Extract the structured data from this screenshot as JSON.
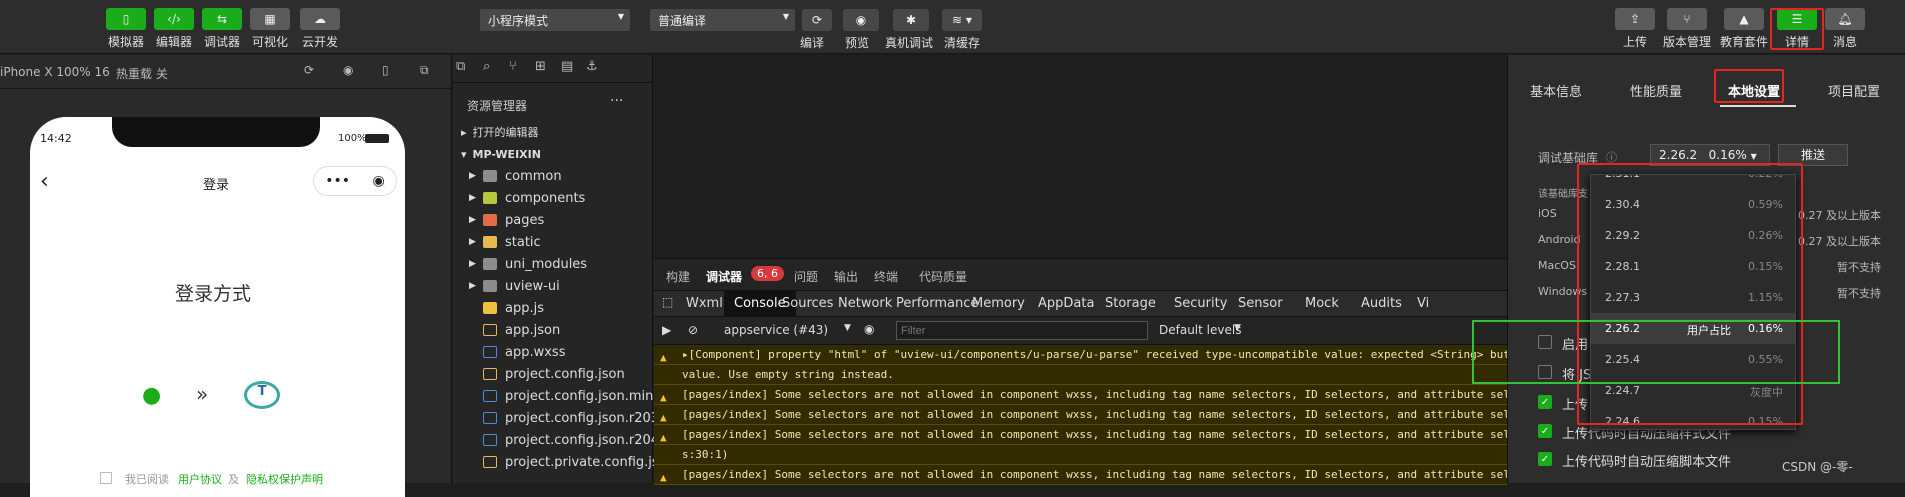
{
  "toolbar": {
    "left_buttons": [
      {
        "label": "模拟器",
        "icon": "phone-icon"
      },
      {
        "label": "编辑器",
        "icon": "code-icon"
      },
      {
        "label": "调试器",
        "icon": "debug-icon"
      },
      {
        "label": "可视化",
        "icon": "layout-icon"
      },
      {
        "label": "云开发",
        "icon": "cloud-icon"
      }
    ],
    "mode_select": "小程序模式",
    "compile_select": "普通编译",
    "mid_buttons": [
      {
        "label": "编译",
        "icon": "refresh-icon"
      },
      {
        "label": "预览",
        "icon": "eye-icon"
      },
      {
        "label": "真机调试",
        "icon": "bug-icon"
      },
      {
        "label": "清缓存",
        "icon": "layers-icon"
      }
    ],
    "right_buttons": [
      {
        "label": "上传",
        "icon": "upload-icon"
      },
      {
        "label": "版本管理",
        "icon": "branch-icon"
      },
      {
        "label": "教育套件",
        "icon": "graduation-icon"
      },
      {
        "label": "详情",
        "icon": "menu-icon"
      },
      {
        "label": "消息",
        "icon": "bell-icon"
      }
    ]
  },
  "simulator": {
    "device": "iPhone X 100% 16",
    "hot_reload": "热重载 关",
    "time": "14:42",
    "battery": "100%",
    "nav_title": "登录",
    "login_heading": "登录方式",
    "agree_text": "我已阅读",
    "link1": "用户协议",
    "and": "及",
    "link2": "隐私权保护声明",
    "arrow_text": "»"
  },
  "explorer": {
    "title": "资源管理器",
    "open_editors": "打开的编辑器",
    "root": "MP-WEIXIN",
    "items": [
      {
        "name": "common",
        "type": "folder"
      },
      {
        "name": "components",
        "type": "folder"
      },
      {
        "name": "pages",
        "type": "folder"
      },
      {
        "name": "static",
        "type": "folder"
      },
      {
        "name": "uni_modules",
        "type": "folder"
      },
      {
        "name": "uview-ui",
        "type": "folder"
      },
      {
        "name": "app.js",
        "type": "js"
      },
      {
        "name": "app.json",
        "type": "json"
      },
      {
        "name": "app.wxss",
        "type": "wxss"
      },
      {
        "name": "project.config.json",
        "type": "json"
      },
      {
        "name": "project.config.json.mine",
        "type": "file"
      },
      {
        "name": "project.config.json.r203",
        "type": "file"
      },
      {
        "name": "project.config.json.r204",
        "type": "file"
      },
      {
        "name": "project.private.config.js...",
        "type": "json"
      }
    ]
  },
  "console": {
    "top_tabs": [
      "构建",
      "调试器",
      "问题",
      "输出",
      "终端",
      "代码质量"
    ],
    "badge": "6, 6",
    "dev_tabs": [
      "Wxml",
      "Console",
      "Sources",
      "Network",
      "Performance",
      "Memory",
      "AppData",
      "Storage",
      "Security",
      "Sensor",
      "Mock",
      "Audits",
      "Vi"
    ],
    "context": "appservice (#43)",
    "filter_placeholder": "Filter",
    "levels": "Default levels",
    "logs": [
      "▸[Component] property \"html\" of \"uview-ui/components/u-parse/u-parse\" received type-uncompatible value: expected <String> but",
      "value. Use empty string instead.",
      "[pages/index] Some selectors are not allowed in component wxss, including tag name selectors, ID selectors, and attribute sele",
      "[pages/index] Some selectors are not allowed in component wxss, including tag name selectors, ID selectors, and attribute sele",
      "[pages/index] Some selectors are not allowed in component wxss, including tag name selectors, ID selectors, and attribute sele",
      "s:30:1)",
      "[pages/index] Some selectors are not allowed in component wxss, including tag name selectors, ID selectors, and attribute sele"
    ]
  },
  "details": {
    "tabs": [
      "基本信息",
      "性能质量",
      "本地设置",
      "项目配置"
    ],
    "debug_lib_label": "调试基础库",
    "debug_lib_value": "2.26.2",
    "debug_lib_pct": "0.16%",
    "push_button": "推送",
    "lib_note": "该基础库支",
    "platforms": [
      {
        "name": "iOS",
        "value": "0.27 及以上版本"
      },
      {
        "name": "Android",
        "value": "0.27 及以上版本"
      },
      {
        "name": "MacOS",
        "value": "暂不支持"
      },
      {
        "name": "Windows",
        "value": "暂不支持"
      }
    ],
    "checkboxes": [
      {
        "label": "启用",
        "checked": false
      },
      {
        "label": "将 JS",
        "checked": false
      },
      {
        "label": "上传",
        "checked": true
      },
      {
        "label": "上传代码时自动压缩样式文件",
        "checked": true
      },
      {
        "label": "上传代码时自动压缩脚本文件",
        "checked": true
      }
    ],
    "dropdown": [
      {
        "ver": "2.31.1",
        "info": "0.22%"
      },
      {
        "ver": "2.30.4",
        "info": "0.59%"
      },
      {
        "ver": "2.29.2",
        "info": "0.26%"
      },
      {
        "ver": "2.28.1",
        "info": "0.15%"
      },
      {
        "ver": "2.27.3",
        "info": "1.15%"
      },
      {
        "ver": "2.26.2",
        "tag": "用户占比",
        "info": "0.16%"
      },
      {
        "ver": "2.25.4",
        "info": "0.55%"
      },
      {
        "ver": "2.24.7",
        "info": "灰度中"
      },
      {
        "ver": "2.24.6",
        "info": "0.15%"
      }
    ]
  },
  "watermark": "CSDN @-零-"
}
